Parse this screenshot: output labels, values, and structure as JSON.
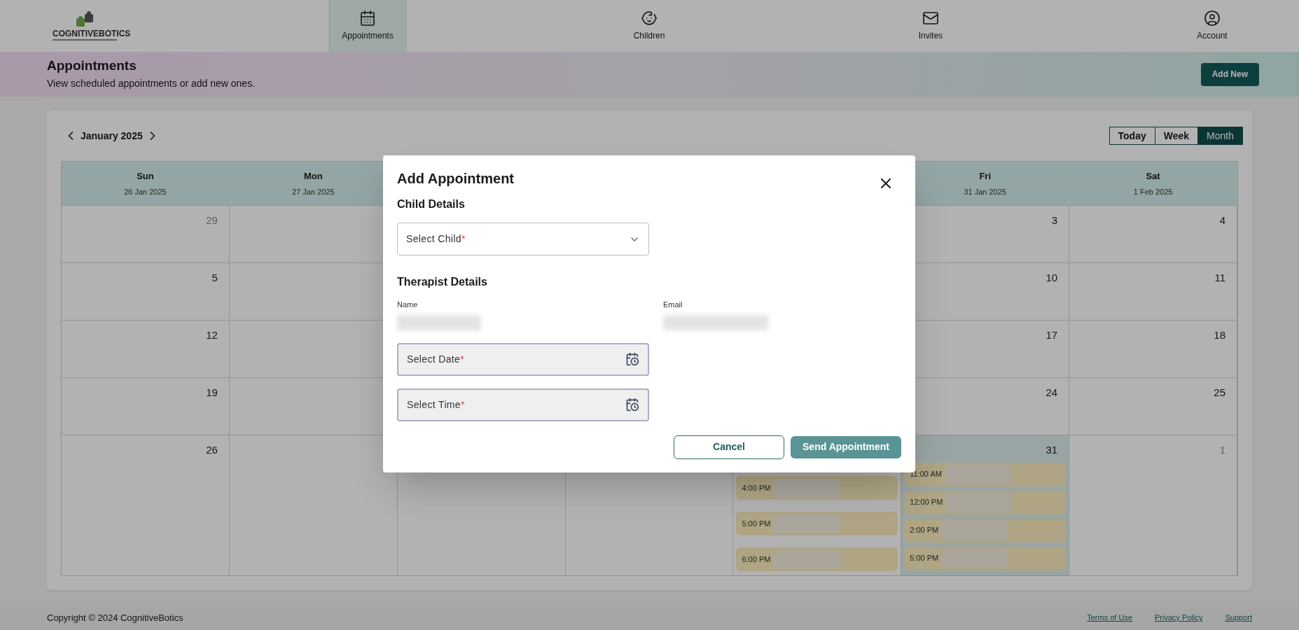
{
  "logo": {
    "text": "COGNITIVE**BOTICS**"
  },
  "nav": [
    {
      "label": "Appointments",
      "selected": true
    },
    {
      "label": "Children",
      "selected": false
    },
    {
      "label": "Invites",
      "selected": false
    },
    {
      "label": "Account",
      "selected": false
    }
  ],
  "banner": {
    "title": "Appointments",
    "subtitle": "View scheduled appointments or add new ones.",
    "button": "Add New"
  },
  "calendar": {
    "month": "January 2025",
    "views": [
      {
        "label": "Today",
        "selected": false
      },
      {
        "label": "Week",
        "selected": false
      },
      {
        "label": "Month",
        "selected": true
      }
    ],
    "columns": {
      "sun": {
        "day": "Sun",
        "date": "26 Jan 2025"
      },
      "mon": {
        "day": "Mon",
        "date": "27 Jan 2025"
      },
      "fri": {
        "day": "Fri",
        "date": "31 Jan 2025"
      },
      "sat": {
        "day": "Sat",
        "date": "1 Feb 2025"
      }
    },
    "weeks": [
      {
        "sun": {
          "number": "29",
          "outside": true,
          "today": false
        },
        "fri": {
          "number": "3",
          "outside": false,
          "today": false
        },
        "sat": {
          "number": "4",
          "outside": false,
          "today": false
        }
      },
      {
        "sun": {
          "number": "5",
          "outside": false,
          "today": false
        },
        "fri": {
          "number": "10",
          "outside": false,
          "today": false
        },
        "sat": {
          "number": "11",
          "outside": false,
          "today": false
        }
      },
      {
        "sun": {
          "number": "12",
          "outside": false,
          "today": false
        },
        "fri": {
          "number": "17",
          "outside": false,
          "today": false
        },
        "sat": {
          "number": "18",
          "outside": false,
          "today": false
        }
      },
      {
        "sun": {
          "number": "19",
          "outside": false,
          "today": false
        },
        "fri": {
          "number": "24",
          "outside": false,
          "today": false
        },
        "sat": {
          "number": "25",
          "outside": false,
          "today": false
        }
      },
      {
        "sun": {
          "number": "26",
          "outside": false,
          "today": false
        },
        "thu": {
          "events": [
            {
              "time": "4:00 PM"
            },
            {
              "time": "5:00 PM"
            },
            {
              "time": "6:00 PM"
            }
          ]
        },
        "fri": {
          "number": "31",
          "outside": false,
          "today": true,
          "events": [
            {
              "time": "11:00 AM"
            },
            {
              "time": "12:00 PM"
            },
            {
              "time": "2:00 PM"
            },
            {
              "time": "5:00 PM"
            }
          ]
        },
        "sat": {
          "number": "1",
          "outside": true,
          "today": false
        }
      }
    ]
  },
  "modal": {
    "title": "Add Appointment",
    "child_heading": "Child Details",
    "child_select": {
      "label": "Select Child",
      "required_mark": "*"
    },
    "therapist_heading": "Therapist Details",
    "name_label": "Name",
    "email_label": "Email",
    "date_field": {
      "label": "Select Date",
      "required_mark": "*"
    },
    "time_field": {
      "label": "Select Time",
      "required_mark": "*"
    },
    "cancel": "Cancel",
    "submit": "Send Appointment"
  },
  "footer": {
    "copyright": "Copyright © 2024 CognitiveBotics",
    "links": [
      "Terms of Use",
      "Privacy Policy",
      "Support"
    ]
  }
}
